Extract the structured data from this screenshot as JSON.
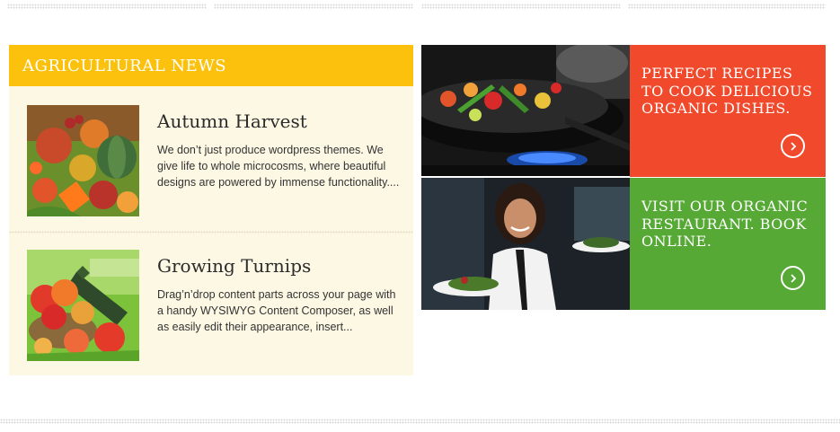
{
  "news": {
    "header": "AGRICULTURAL NEWS",
    "posts": [
      {
        "title": "Autumn Harvest",
        "excerpt": "We don’t just produce wordpress themes. We give life to whole microcosms, where beautiful designs are powered by immense functionality....",
        "image": "autumn-harvest-vegetables"
      },
      {
        "title": "Growing Turnips",
        "excerpt": "Drag’n’drop content parts across your page with a handy WYSIWYG Content Composer, as well as easily edit their appearance, insert...",
        "image": "apples-basket-grass"
      }
    ]
  },
  "promos": [
    {
      "text": "PERFECT RECIPES TO COOK DELICIOUS ORGANIC DISHES.",
      "color": "#f1492b",
      "image": "wok-cooking-vegetables",
      "icon": "chevron-right-icon"
    },
    {
      "text": "VISIT OUR ORGANIC RESTAURANT. BOOK ONLINE.",
      "color": "#56a935",
      "image": "waitress-serving-salad",
      "icon": "chevron-right-icon"
    }
  ],
  "colors": {
    "header": "#fcc10c",
    "news_bg": "#fdf8e4",
    "recipe_box": "#f1492b",
    "restaurant_box": "#56a935"
  }
}
